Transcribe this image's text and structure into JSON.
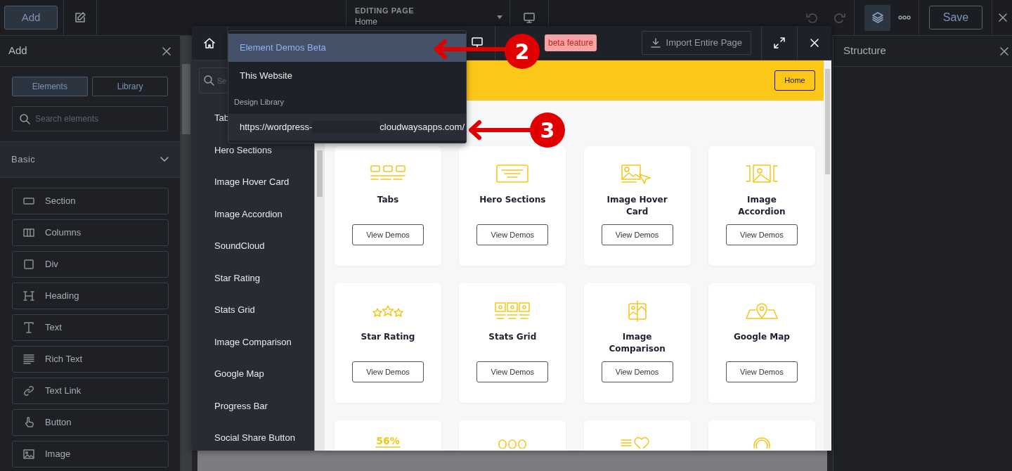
{
  "topbar": {
    "add_button": "Add",
    "editing_label": "EDITING PAGE",
    "page_name": "Home",
    "save_button": "Save",
    "layers_active": true
  },
  "add_panel": {
    "title": "Add",
    "tabs": [
      {
        "label": "Elements",
        "selected": true
      },
      {
        "label": "Library",
        "selected": false
      }
    ],
    "search": {
      "placeholder": "Search elements"
    },
    "section": {
      "title": "Basic",
      "expanded": true
    },
    "elements": [
      {
        "label": "Section"
      },
      {
        "label": "Columns"
      },
      {
        "label": "Div"
      },
      {
        "label": "Heading"
      },
      {
        "label": "Text"
      },
      {
        "label": "Rich Text"
      },
      {
        "label": "Text Link"
      },
      {
        "label": "Button"
      },
      {
        "label": "Image"
      }
    ]
  },
  "structure_panel": {
    "title": "Structure"
  },
  "library_modal": {
    "badge": "beta feature",
    "import_button": "Import Entire Page",
    "source_menu": [
      {
        "kind": "option",
        "label": "Element Demos Beta",
        "selected": true
      },
      {
        "kind": "option",
        "label": "This Website",
        "selected": false
      },
      {
        "kind": "header",
        "label": "Design Library"
      },
      {
        "kind": "url",
        "url_start": "https://wordpress-",
        "url_end": "cloudwaysapps.com/",
        "highlighted": true
      }
    ],
    "search": {
      "placeholder": "Se"
    },
    "categories": [
      "Tab",
      "Hero Sections",
      "Image Hover Card",
      "Image Accordion",
      "SoundCloud",
      "Star Rating",
      "Stats Grid",
      "Image Comparison",
      "Google Map",
      "Progress Bar",
      "Social Share Button"
    ],
    "preview": {
      "nav_button": "Home",
      "cards": [
        {
          "title": "Tabs",
          "button": "View Demos"
        },
        {
          "title": "Hero Sections",
          "button": "View Demos"
        },
        {
          "title": "Image Hover Card",
          "button": "View Demos"
        },
        {
          "title": "Image Accordion",
          "button": "View Demos"
        },
        {
          "title": "Star Rating",
          "button": "View Demos"
        },
        {
          "title": "Stats Grid",
          "button": "View Demos"
        },
        {
          "title": "Image Comparison",
          "button": "View Demos"
        },
        {
          "title": "Google Map",
          "button": "View Demos"
        },
        {
          "kind": "partial",
          "icon_text": "56%"
        },
        {
          "kind": "partial"
        },
        {
          "kind": "partial"
        },
        {
          "kind": "partial"
        }
      ]
    }
  },
  "annotations": [
    {
      "number": "2"
    },
    {
      "number": "3"
    }
  ]
}
